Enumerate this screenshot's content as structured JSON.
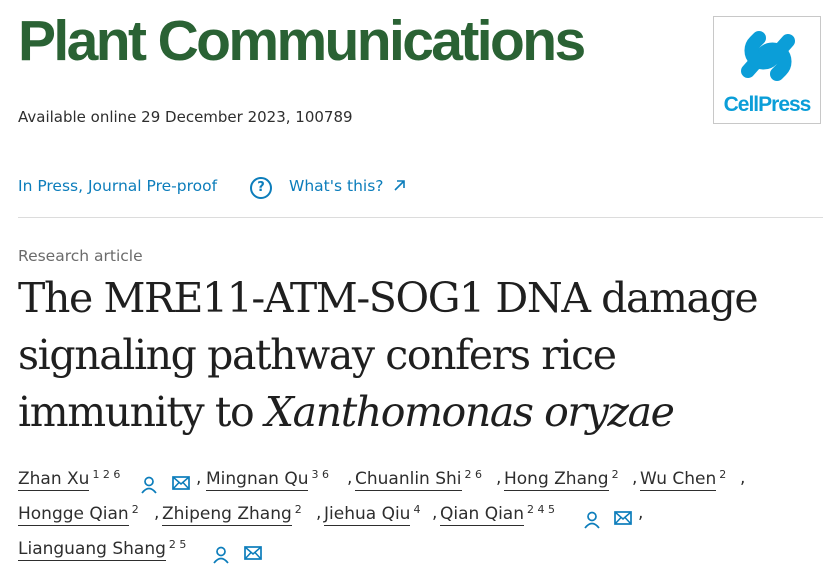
{
  "journal": {
    "title": "Plant Communications",
    "publisher_logo": "CellPress"
  },
  "meta": {
    "available": "Available online 29 December 2023, 100789",
    "status": "In Press, Journal Pre-proof",
    "whats_this": "What's this?",
    "help_symbol": "?"
  },
  "article": {
    "type": "Research article",
    "title_line1": "The MRE11-ATM-SOG1 DNA damage",
    "title_line2": "signaling pathway confers rice",
    "title_line3_plain": "immunity to ",
    "title_line3_italic": "Xanthomonas oryzae"
  },
  "authors": [
    {
      "name": "Zhan Xu",
      "sup": "1 2 6"
    },
    {
      "name": "Mingnan Qu",
      "sup": "3 6"
    },
    {
      "name": "Chuanlin Shi",
      "sup": "2 6"
    },
    {
      "name": "Hong Zhang",
      "sup": "2"
    },
    {
      "name": "Wu Chen",
      "sup": "2"
    },
    {
      "name": "Hongge Qian",
      "sup": "2"
    },
    {
      "name": "Zhipeng Zhang",
      "sup": "2"
    },
    {
      "name": "Jiehua Qiu",
      "sup": "4"
    },
    {
      "name": "Qian Qian",
      "sup": "2 4 5"
    },
    {
      "name": "Lianguang Shang",
      "sup": "2 5"
    }
  ],
  "punctuation": {
    "comma": ","
  },
  "colors": {
    "journal_green": "#2a6234",
    "link_blue": "#0c7dbb",
    "cellpress_blue": "#0b9ed8"
  },
  "icons": [
    "person-icon",
    "envelope-icon",
    "question-circle-icon",
    "external-link-arrow-icon"
  ]
}
